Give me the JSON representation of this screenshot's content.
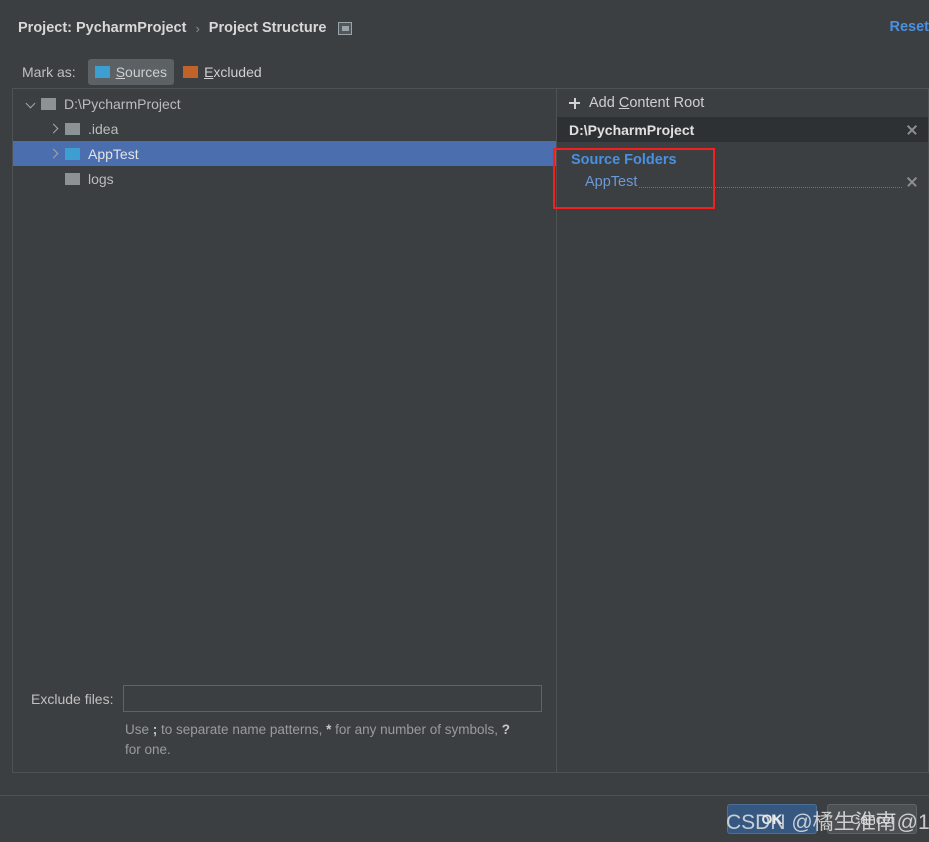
{
  "breadcrumb": {
    "project_crumb": "Project: PycharmProject",
    "separator": "›",
    "current_crumb": "Project Structure",
    "toggle_icon": "panel-toggle-icon",
    "reset_label": "Reset"
  },
  "markas": {
    "label": "Mark as:",
    "buttons": [
      {
        "label": "Sources",
        "icon": "blue-folder-icon",
        "color": "#3d9fd1",
        "active": true
      },
      {
        "label": "Excluded",
        "icon": "orange-folder-icon",
        "color": "#c0622a",
        "active": false
      }
    ]
  },
  "tree": {
    "rows": [
      {
        "name": "D:\\PycharmProject",
        "indent": 0,
        "twisty": "down",
        "folder": "grey",
        "selected": false
      },
      {
        "name": ".idea",
        "indent": 1,
        "twisty": "right",
        "folder": "grey",
        "selected": false
      },
      {
        "name": "AppTest",
        "indent": 1,
        "twisty": "right",
        "folder": "src",
        "selected": true
      },
      {
        "name": "logs",
        "indent": 1,
        "twisty": "none",
        "folder": "grey",
        "selected": false
      }
    ]
  },
  "exclude": {
    "label": "Exclude files:",
    "value": "",
    "placeholder": "",
    "hint_part1": "Use ",
    "hint_sep": ";",
    "hint_part2": " to separate name patterns, ",
    "hint_star": "*",
    "hint_part3": " for any number of symbols, ",
    "hint_q": "?",
    "hint_part4": " for one.",
    "hint_full": "Use ; to separate name patterns, * for any number of symbols, ? for one."
  },
  "detail": {
    "add_content_root": "Add Content Root",
    "root_path": "D:\\PycharmProject",
    "close_icon": "close-icon",
    "group_title": "Source Folders",
    "entries": [
      {
        "name": "AppTest"
      }
    ]
  },
  "annotation": {
    "color": "#f42020"
  },
  "footer": {
    "ok_label": "OK",
    "cancel_label": "Cancel"
  },
  "watermark": {
    "text": "CSDN @橘生淮南@1"
  },
  "colors": {
    "background": "#3c3f41",
    "selection": "#4b6eaf",
    "accent_blue": "#4a90e2",
    "source_folder": "#3d9fd1",
    "excluded_folder": "#c0622a",
    "annotation_red": "#f42020",
    "primary_button": "#365880"
  }
}
